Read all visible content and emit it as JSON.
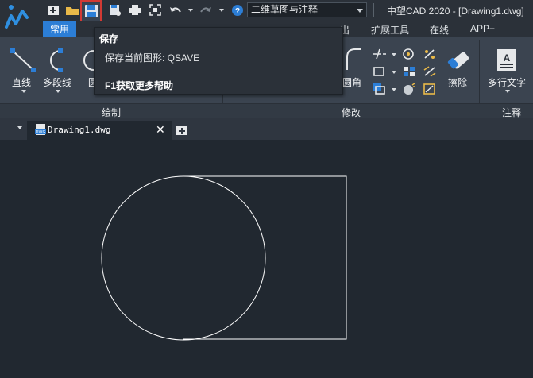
{
  "titlebar": {
    "workspace": "二维草图与注释",
    "app_title": "中望CAD 2020 - [Drawing1.dwg]"
  },
  "tabs": {
    "home": "常用",
    "output_partial": "出",
    "extensions": "扩展工具",
    "online": "在线",
    "app": "APP+"
  },
  "ribbon": {
    "line": "直线",
    "polyline": "多段线",
    "circle_partial": "圆",
    "fillet_partial": "圆角",
    "erase": "擦除",
    "mtext": "多行文字",
    "panel_draw": "绘制",
    "panel_modify": "修改",
    "panel_annotate": "注释"
  },
  "tooltip": {
    "title": "保存",
    "description": "保存当前图形:  QSAVE",
    "help": "F1获取更多帮助"
  },
  "document": {
    "tab_label": "Drawing1.dwg",
    "close": "✕"
  },
  "colors": {
    "accent": "#2c7ed6",
    "highlight": "#d33a34",
    "canvas": "#212830"
  }
}
